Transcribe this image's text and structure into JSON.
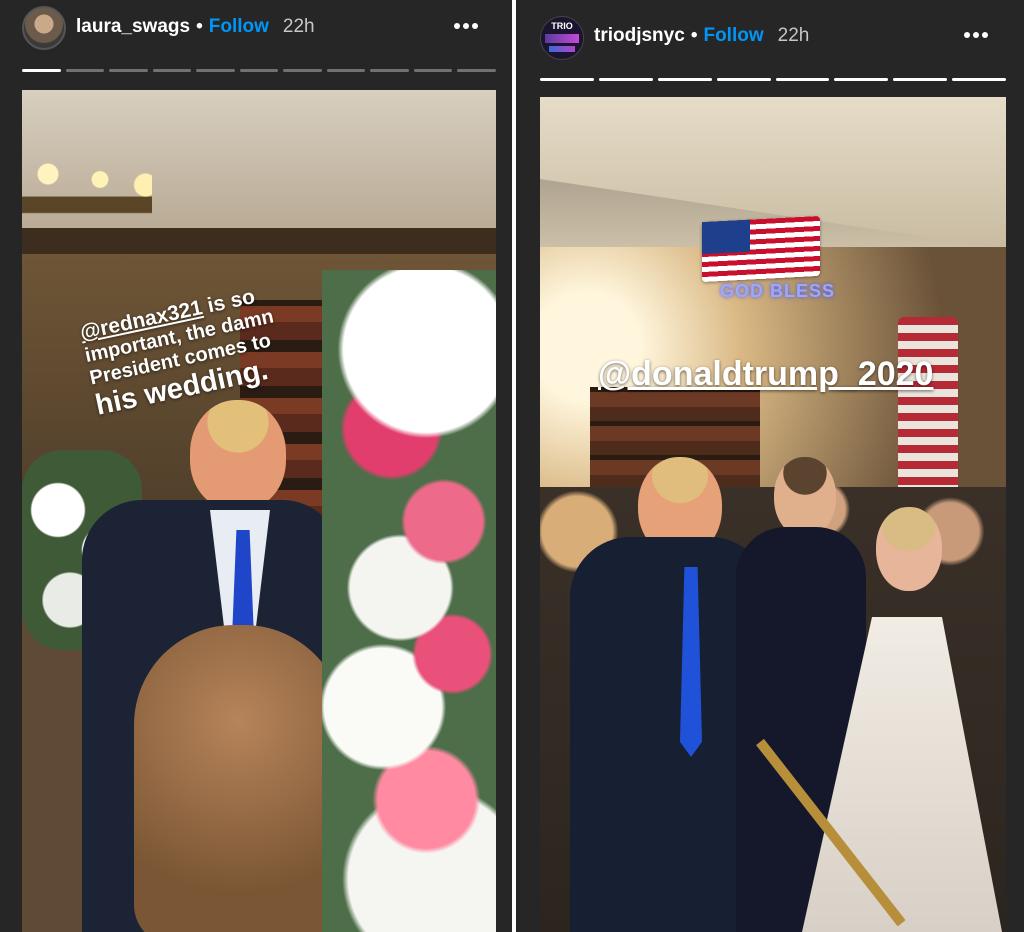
{
  "stories": [
    {
      "username": "laura_swags",
      "separator": "•",
      "follow_label": "Follow",
      "time": "22h",
      "progress": {
        "segments": 11,
        "active": 1
      },
      "caption": {
        "mention": "@rednax321",
        "line1_rest": " is so",
        "line2": "important, the damn",
        "line3": "President comes to",
        "line4": "his wedding."
      }
    },
    {
      "username": "triodjsnyc",
      "separator": "•",
      "follow_label": "Follow",
      "time": "22h",
      "avatar_text": "TRIO",
      "progress": {
        "segments": 8,
        "active": 8
      },
      "gif_text": "GOD BLESS",
      "mention": "@donaldtrump_2020"
    }
  ],
  "colors": {
    "story_bg": "#262626",
    "follow": "#0095f6",
    "text": "#ffffff",
    "time": "#c7c7c7"
  },
  "icons": [
    "more-options-icon",
    "flag-gif"
  ]
}
